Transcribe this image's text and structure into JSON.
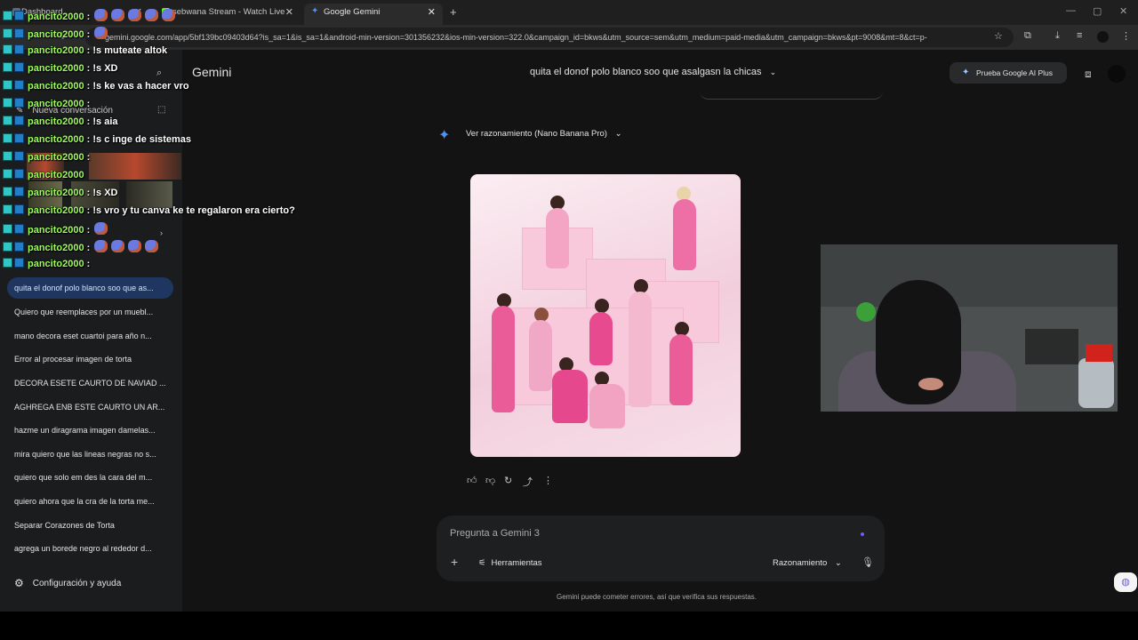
{
  "browser": {
    "tabs": [
      {
        "label": "Dashboard"
      },
      {
        "label": "sebwana Stream - Watch Live"
      },
      {
        "label": "Google Gemini"
      }
    ],
    "new_tab": "+",
    "url": "gemini.google.com/app/5bf139bc09403d64?is_sa=1&is_sa=1&android-min-version=301356232&ios-min-version=322.0&campaign_id=bkws&utm_source=sem&utm_medium=paid-media&utm_campaign=bkws&pt=9008&mt=8&ct=p-"
  },
  "gemini": {
    "brand": "Gemini",
    "conversation_title": "quita el donof polo blanco soo que asalgasn la chicas",
    "upgrade_button": "Prueba Google AI Plus",
    "reasoning_label": "Ver razonamiento (Nano Banana Pro)",
    "prompt_placeholder": "Pregunta a Gemini 3",
    "tools_label": "Herramientas",
    "mode_label": "Razonamiento",
    "disclaimer": "Gemini puede cometer errores, así que verifica sus respuestas."
  },
  "sidebar": {
    "new_chat": "Nueva conversación",
    "recents": [
      "quita el donof polo blanco soo que as...",
      "Quiero que reemplaces por un muebl...",
      "mano decora eset cuartoi para año n...",
      "Error al procesar imagen de torta",
      "DECORA ESETE CAURTO DE NAVIAD ...",
      "AGHREGA ENB ESTE CAURTO UN AR...",
      "hazme un diragrama imagen damelas...",
      "mira quiero que las lineas negras no s...",
      "quiero que solo em des la cara del m...",
      "quiero ahora que la cra de la torta me...",
      "Separar Corazones de Torta",
      "agrega un borede negro al rededor d..."
    ],
    "settings": "Configuración y ayuda"
  },
  "chat_overlay": {
    "messages": [
      {
        "user": "pancito2000",
        "text": ""
      },
      {
        "user": "pancito2000",
        "text": ""
      },
      {
        "user": "pancito2000",
        "text": "!s muteate altok"
      },
      {
        "user": "pancito2000",
        "text": "!s XD"
      },
      {
        "user": "pancito2000",
        "text": "!s ke vas a hacer vro"
      },
      {
        "user": "pancito2000",
        "text": ""
      },
      {
        "user": "pancito2000",
        "text": "!s aia"
      },
      {
        "user": "pancito2000",
        "text": "!s c inge de sistemas"
      },
      {
        "user": "pancito2000",
        "text": ""
      },
      {
        "user": "pancito2000",
        "text": ""
      },
      {
        "user": "pancito2000",
        "text": "!s XD"
      },
      {
        "user": "pancito2000",
        "text": "!s vro y tu canva ke te regalaron era cierto?"
      },
      {
        "user": "pancito2000",
        "text": ""
      },
      {
        "user": "pancito2000",
        "text": ""
      },
      {
        "user": "pancito2000",
        "text": ""
      }
    ]
  },
  "colors": {
    "background": "#131314",
    "sidebar": "#1b1c1d",
    "active_item": "#1f3760",
    "chat_username": "#9cff56",
    "accent": "#4f8ff7"
  }
}
